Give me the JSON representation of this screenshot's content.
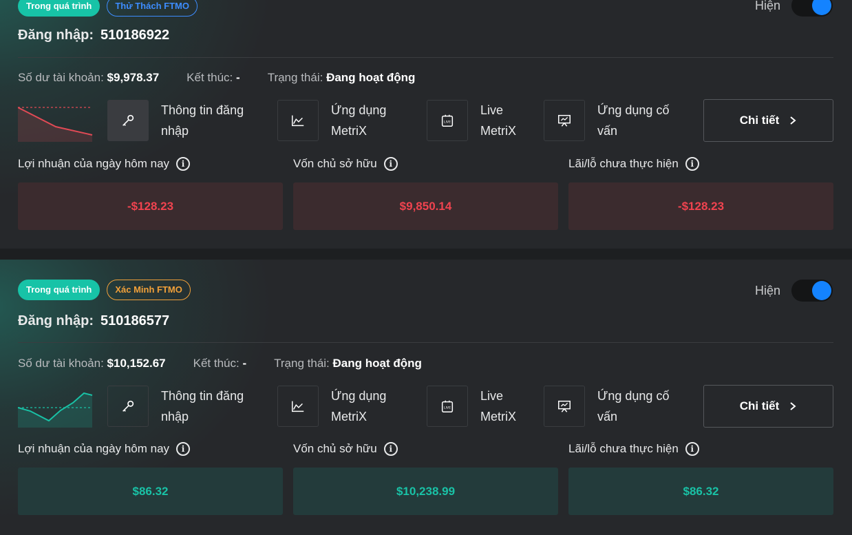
{
  "visibility_label": "Hiện",
  "login_label": "Đăng nhập:",
  "balance_label": "Số dư tài khoản:",
  "end_label": "Kết thúc:",
  "status_label": "Trạng thái:",
  "actions": {
    "credentials": "Thông tin đăng\nnhập",
    "metrix": "Ứng dụng\nMetriX",
    "live_metrix": "Live\nMetriX",
    "mentor": "Ứng dụng cố\nvấn",
    "detail": "Chi tiết"
  },
  "metric_labels": {
    "today_profit": "Lợi nhuận của ngày hôm nay",
    "equity": "Vốn chủ sở hữu",
    "unrealized": "Lãi/lỗ chưa thực hiện"
  },
  "colors": {
    "accent": "#17c3a7",
    "toggle": "#1483ff",
    "negative": "#f0434f",
    "positive": "#19c2a6"
  },
  "accounts": [
    {
      "progress_tag": "Trong quá trình",
      "phase_tag": "Thử Thách FTMO",
      "login": "510186922",
      "balance": "$9,978.37",
      "end": "-",
      "status": "Đang hoạt động",
      "visible": true,
      "today_profit": "-$128.23",
      "equity": "$9,850.14",
      "unrealized": "-$128.23",
      "trend": "down"
    },
    {
      "progress_tag": "Trong quá trình",
      "phase_tag": "Xác Minh FTMO",
      "login": "510186577",
      "balance": "$10,152.67",
      "end": "-",
      "status": "Đang hoạt động",
      "visible": true,
      "today_profit": "$86.32",
      "equity": "$10,238.99",
      "unrealized": "$86.32",
      "trend": "up"
    }
  ]
}
